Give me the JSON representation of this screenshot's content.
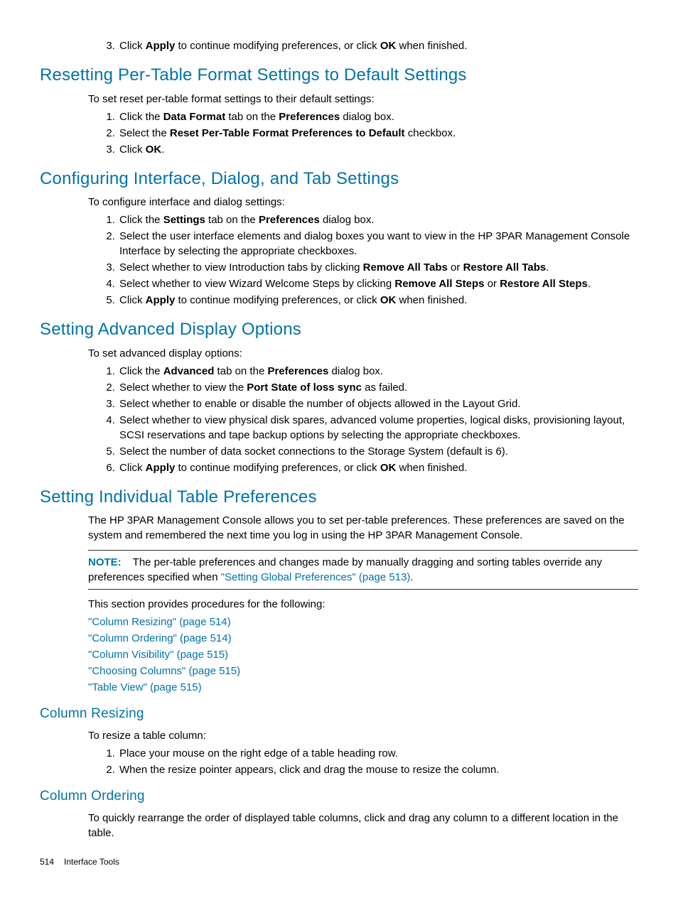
{
  "top_item": {
    "num": "3.",
    "t1": "Click ",
    "b1": "Apply",
    "t2": " to continue modifying preferences, or click ",
    "b2": "OK",
    "t3": " when finished."
  },
  "sec1": {
    "heading": "Resetting Per-Table Format Settings to Default Settings",
    "intro": "To set reset per-table format settings to their default settings:",
    "i1": {
      "t1": "Click the ",
      "b1": "Data Format",
      "t2": " tab on the ",
      "b2": "Preferences",
      "t3": " dialog box."
    },
    "i2": {
      "t1": "Select the ",
      "b1": "Reset Per-Table Format Preferences to Default",
      "t2": " checkbox."
    },
    "i3": {
      "t1": "Click ",
      "b1": "OK",
      "t2": "."
    }
  },
  "sec2": {
    "heading": "Configuring Interface, Dialog, and Tab Settings",
    "intro": "To configure interface and dialog settings:",
    "i1": {
      "t1": "Click the ",
      "b1": "Settings",
      "t2": " tab on the ",
      "b2": "Preferences",
      "t3": " dialog box."
    },
    "i2": {
      "t1": "Select the user interface elements and dialog boxes you want to view in the HP 3PAR Management Console Interface by selecting the appropriate checkboxes."
    },
    "i3": {
      "t1": "Select whether to view Introduction tabs by clicking ",
      "b1": "Remove All Tabs",
      "t2": " or ",
      "b2": "Restore All Tabs",
      "t3": "."
    },
    "i4": {
      "t1": "Select whether to view Wizard Welcome Steps by clicking ",
      "b1": "Remove All Steps",
      "t2": " or ",
      "b2": "Restore All Steps",
      "t3": "."
    },
    "i5": {
      "t1": "Click ",
      "b1": "Apply",
      "t2": " to continue modifying preferences, or click ",
      "b2": "OK",
      "t3": " when finished."
    }
  },
  "sec3": {
    "heading": "Setting Advanced Display Options",
    "intro": "To set advanced display options:",
    "i1": {
      "t1": "Click the ",
      "b1": "Advanced",
      "t2": " tab on the ",
      "b2": "Preferences",
      "t3": " dialog box."
    },
    "i2": {
      "t1": "Select whether to view the ",
      "b1": "Port State of loss sync",
      "t2": " as failed."
    },
    "i3": {
      "t1": "Select whether to enable or disable the number of objects allowed in the Layout Grid."
    },
    "i4": {
      "t1": "Select whether to view physical disk spares, advanced volume properties, logical disks, provisioning layout, SCSI reservations and tape backup options by selecting the appropriate checkboxes."
    },
    "i5": {
      "t1": "Select the number of data socket connections to the Storage System (default is 6)."
    },
    "i6": {
      "t1": "Click ",
      "b1": "Apply",
      "t2": " to continue modifying preferences, or click ",
      "b2": "OK",
      "t3": " when finished."
    }
  },
  "sec4": {
    "heading": "Setting Individual Table Preferences",
    "para1": "The HP 3PAR Management Console allows you to set per-table preferences. These preferences are saved on the system and remembered the next time you log in using the HP 3PAR Management Console.",
    "note_label": "NOTE:",
    "note_t1": "The per-table preferences and changes made by manually dragging and sorting tables override any preferences specified when ",
    "note_link": "\"Setting Global Preferences\" (page 513)",
    "note_t2": ".",
    "para2": "This section provides procedures for the following:",
    "links": {
      "l1": "\"Column Resizing\" (page 514)",
      "l2": "\"Column Ordering\" (page 514)",
      "l3": "\"Column Visibility\" (page 515)",
      "l4": "\"Choosing Columns\" (page 515)",
      "l5": "\"Table View\" (page 515)"
    }
  },
  "sec5": {
    "heading": "Column Resizing",
    "intro": "To resize a table column:",
    "i1": "Place your mouse on the right edge of a table heading row.",
    "i2": "When the resize pointer appears, click and drag the mouse to resize the column."
  },
  "sec6": {
    "heading": "Column Ordering",
    "para": "To quickly rearrange the order of displayed table columns, click and drag any column to a different location in the table."
  },
  "footer": {
    "page": "514",
    "title": "Interface Tools"
  }
}
